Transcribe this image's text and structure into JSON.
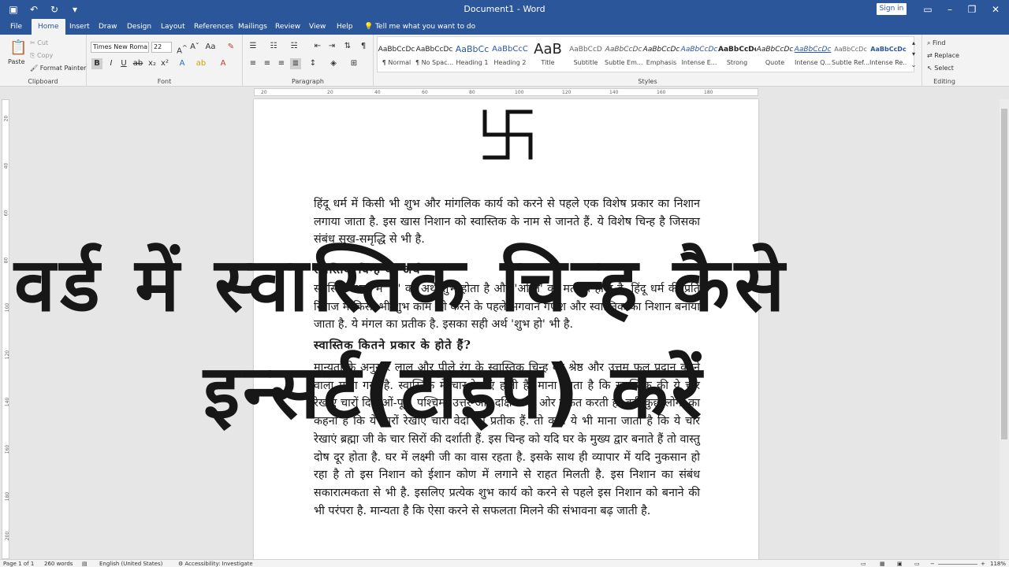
{
  "window": {
    "title": "Document1 - Word",
    "sign_in": "Sign in"
  },
  "tabs": [
    "File",
    "Home",
    "Insert",
    "Draw",
    "Design",
    "Layout",
    "References",
    "Mailings",
    "Review",
    "View",
    "Help"
  ],
  "active_tab": "Home",
  "tell_me": "Tell me what you want to do",
  "clipboard": {
    "paste": "Paste",
    "cut": "Cut",
    "copy": "Copy",
    "format_painter": "Format Painter",
    "label": "Clipboard"
  },
  "font": {
    "name": "Times New Roma",
    "size": "22",
    "label": "Font"
  },
  "paragraph": {
    "label": "Paragraph"
  },
  "styles": {
    "label": "Styles",
    "items": [
      {
        "sample": "AaBbCcDc",
        "name": "¶ Normal"
      },
      {
        "sample": "AaBbCcDc",
        "name": "¶ No Spac..."
      },
      {
        "sample": "AaBbCc",
        "name": "Heading 1"
      },
      {
        "sample": "AaBbCcC",
        "name": "Heading 2"
      },
      {
        "sample": "AaB",
        "name": "Title"
      },
      {
        "sample": "AaBbCcD",
        "name": "Subtitle"
      },
      {
        "sample": "AaBbCcDc",
        "name": "Subtle Em..."
      },
      {
        "sample": "AaBbCcDc",
        "name": "Emphasis"
      },
      {
        "sample": "AaBbCcDc",
        "name": "Intense E..."
      },
      {
        "sample": "AaBbCcDc",
        "name": "Strong"
      },
      {
        "sample": "AaBbCcDc",
        "name": "Quote"
      },
      {
        "sample": "AaBbCcDc",
        "name": "Intense Q..."
      },
      {
        "sample": "AaBbCcDc",
        "name": "Subtle Ref..."
      },
      {
        "sample": "AaBbCcDc",
        "name": "Intense Re..."
      }
    ]
  },
  "editing": {
    "find": "Find",
    "replace": "Replace",
    "select": "Select",
    "label": "Editing"
  },
  "ruler_ticks": [
    "20",
    "20",
    "40",
    "60",
    "80",
    "100",
    "120",
    "140",
    "160",
    "180"
  ],
  "vruler_ticks": [
    "20",
    "40",
    "60",
    "80",
    "100",
    "120",
    "140",
    "160",
    "180",
    "200",
    "220"
  ],
  "document": {
    "para1": "हिंदू धर्म में किसी भी शुभ और मांगलिक कार्य को करने से पहले एक विशेष प्रकार का निशान लगाया जाता है. इस खास निशान को स्वास्तिक के नाम से जानते हैं. ये विशेष चिन्ह है जिसका संबंध सुख-समृद्धि से भी है.",
    "heading1": "स्वास्तिक चिन्ह का अर्थ",
    "para2": "स्वास्तिक शब्द में 'सु' का अर्थ शुभ होता है और 'अस्ति' का मतलब होना है. हिंदू धर्म की प्रति रिवाज में किसी भी शुभ काम को करने के पहले भगवान गणेश और स्वास्तिक का निशान बनाया जाता है. ये मंगल का प्रतीक है. इसका सही अर्थ 'शुभ हो' भी है.",
    "heading2": "स्वास्तिक कितने प्रकार के होते हैं?",
    "para3": "मान्यता के अनुसार लाल और पीले रंग के स्वास्तिक चिन्ह को श्रेष्ठ और उत्तम फल प्रदान करने वाला माना गया है. स्वास्तिक में चार रेखाएं होती हैं. माना जाता है कि स्वास्तिक की ये चार रेखाएं चारों दिशाओं-पूर्व, पश्चिम, उत्तर और दक्षिण की ओर संकेत करती है. वहीं कुछ लोगों का कहना है कि ये चारों रेखाएं चारों वेदों का प्रतीक हैं. तो कहीं ये भी माना जाता है कि ये चार रेखाएं ब्रह्मा जी के चार सिरों की दर्शाती हैं. इस चिन्ह को यदि घर के मुख्य द्वार बनाते हैं तो वास्तु दोष दूर होता है. घर में लक्ष्मी जी का वास रहता है. इसके साथ ही व्यापार में यदि नुकसान हो रहा है तो इस निशान को ईशान कोण में लगाने से राहत मिलती है. इस निशान का संबंध सकारात्मकता से भी है. इसलिए प्रत्येक शुभ कार्य को करने से पहले इस निशान को बनाने की भी परंपरा है. मान्यता है कि ऐसा करने से सफलता मिलने की संभावना बढ़ जाती है."
  },
  "overlay": {
    "line1": "वर्ड में स्वास्तिक चिन्ह कैसे",
    "line2": "इन्सर्ट(टाइप) करें"
  },
  "status": {
    "page": "Page 1 of 1",
    "words": "260 words",
    "language": "English (United States)",
    "accessibility": "Accessibility: Investigate",
    "zoom": "118%"
  }
}
